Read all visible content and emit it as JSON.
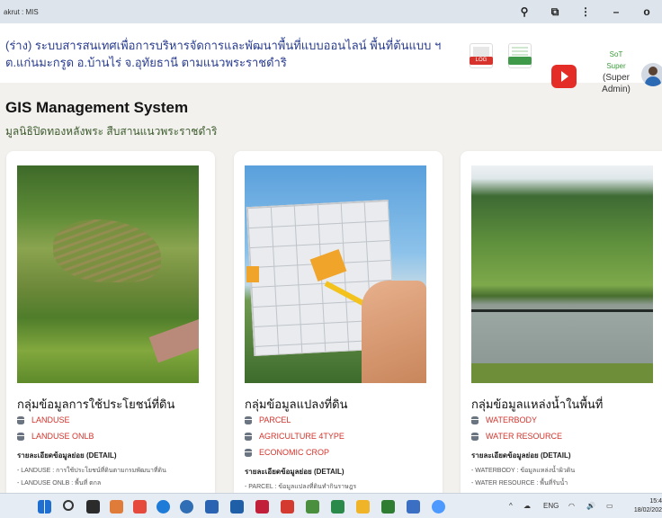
{
  "window": {
    "title": "akrut : MIS",
    "controls": [
      "search-icon",
      "extension-icon",
      "more-icon",
      "minimize-icon",
      "close-icon"
    ]
  },
  "header": {
    "line1": "(ร่าง) ระบบสารสนเทศเพื่อการบริหารจัดการและพัฒนาพื้นที่แบบออนไลน์ พื้นที่ต้นแบบ ฯ",
    "line2": "ต.แก่นมะกรูด อ.บ้านไร่ จ.อุทัยธานี ตามแนวพระราชดำริ",
    "icons": [
      "log-file-icon",
      "spreadsheet-icon",
      "youtube-icon"
    ],
    "user": {
      "name": "SoT",
      "role": "Super",
      "role_full": "(Super Admin)"
    }
  },
  "page": {
    "title": "GIS Management System",
    "subtitle": "มูลนิธิปิดทองหลังพระ สืบสานแนวพระราชดำริ"
  },
  "cards": [
    {
      "title": "กลุ่มข้อมูลการใช้ประโยชน์ที่ดิน",
      "items": [
        "LANDUSE",
        "LANDUSE ONLB"
      ],
      "detail_label": "รายละเอียดข้อมูลย่อย (DETAIL)",
      "details": [
        "- LANDUSE : การใช้ประโยชน์ที่ดินตามกรมพัฒนาที่ดิน",
        "- LANDUSE ONLB : พื้นที่ ตกล"
      ]
    },
    {
      "title": "กลุ่มข้อมูลแปลงที่ดิน",
      "items": [
        "PARCEL",
        "AGRICULTURE 4TYPE",
        "ECONOMIC CROP"
      ],
      "detail_label": "รายละเอียดข้อมูลย่อย (DETAIL)",
      "details": [
        "- PARCEL : ข้อมูลแปลงที่ดินทำกินราษฎร"
      ]
    },
    {
      "title": "กลุ่มข้อมูลแหล่งน้ำในพื้นที่",
      "items": [
        "WATERBODY",
        "WATER RESOURCE"
      ],
      "detail_label": "รายละเอียดข้อมูลย่อย (DETAIL)",
      "details": [
        "- WATERBODY : ข้อมูลแหล่งน้ำผิวดิน",
        "- WATER RESOURCE : พื้นที่รับน้ำ"
      ]
    }
  ],
  "taskbar": {
    "lang": "ENG",
    "time": "15:4",
    "date": "18/02/202"
  },
  "colors": {
    "accent_red": "#d4342c",
    "header_text": "#2a3d8f"
  }
}
